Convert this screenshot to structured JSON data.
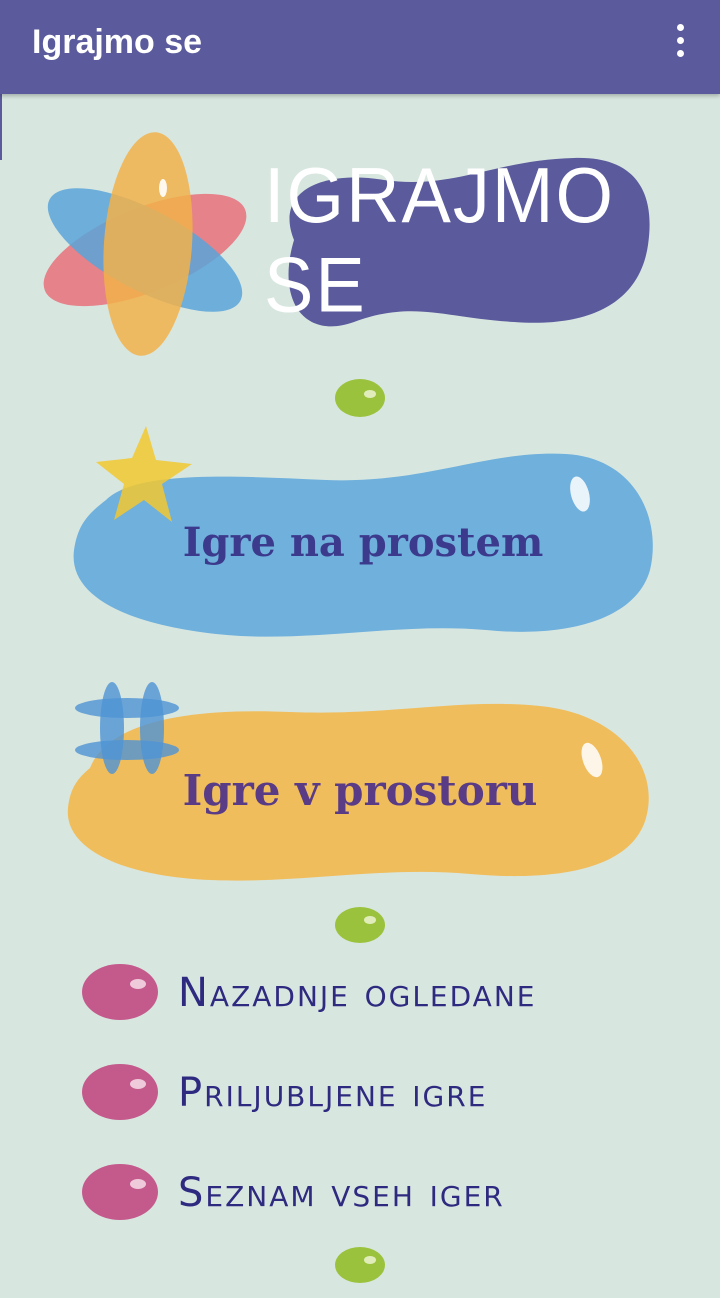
{
  "appbar": {
    "title": "Igrajmo se",
    "overflow_icon": "more-vert-icon"
  },
  "logo": {
    "text": "IGRAJMO SE",
    "icon": "colorful-star-logo"
  },
  "buttons": {
    "outdoor": {
      "label": "Igre na prostem",
      "icon": "yellow-star-icon",
      "color": "#6fb0dc"
    },
    "indoor": {
      "label": "Igre v prostoru",
      "icon": "blue-hash-icon",
      "color": "#f0bd5c"
    }
  },
  "menu": [
    {
      "label": "Nazadnje ogledane",
      "icon": "pink-bead-icon"
    },
    {
      "label": "Priljubljene igre",
      "icon": "pink-bead-icon"
    },
    {
      "label": "Seznam vseh iger",
      "icon": "pink-bead-icon"
    }
  ],
  "colors": {
    "appbar": "#5a5a9c",
    "background": "#d8e6e0",
    "green_bead": "#9ac23c",
    "pink_bead": "#c45a8c",
    "logo_blob": "#5a5a9c"
  }
}
